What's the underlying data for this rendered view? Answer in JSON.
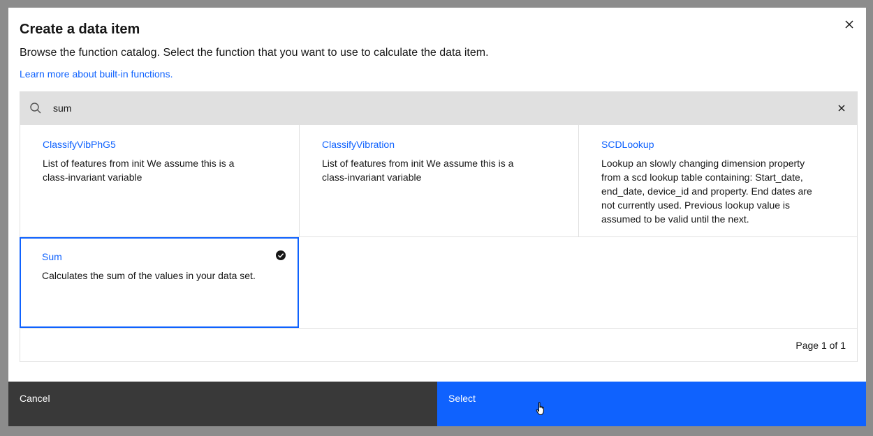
{
  "modal": {
    "title": "Create a data item",
    "subtitle": "Browse the function catalog. Select the function that you want to use to calculate the data item.",
    "link": "Learn more about built-in functions."
  },
  "search": {
    "value": "sum",
    "icon": "search-icon",
    "clear_icon": "close-icon"
  },
  "functions": [
    {
      "name": "ClassifyVibPhG5",
      "description": "List of features from init We assume this is a class-invariant variable",
      "selected": false
    },
    {
      "name": "ClassifyVibration",
      "description": "List of features from init We assume this is a class-invariant variable",
      "selected": false
    },
    {
      "name": "SCDLookup",
      "description": "Lookup an slowly changing dimension property from a scd lookup table containing: Start_date, end_date, device_id and property. End dates are not currently used. Previous lookup value is assumed to be valid until the next.",
      "selected": false
    },
    {
      "name": "Sum",
      "description": "Calculates the sum of the values in your data set.",
      "selected": true
    }
  ],
  "pagination": {
    "text": "Page 1 of 1"
  },
  "footer": {
    "cancel_label": "Cancel",
    "select_label": "Select"
  },
  "colors": {
    "primary": "#0f62fe",
    "secondary_button": "#393939",
    "search_bg": "#e0e0e0",
    "overlay": "#8c8c8c"
  }
}
